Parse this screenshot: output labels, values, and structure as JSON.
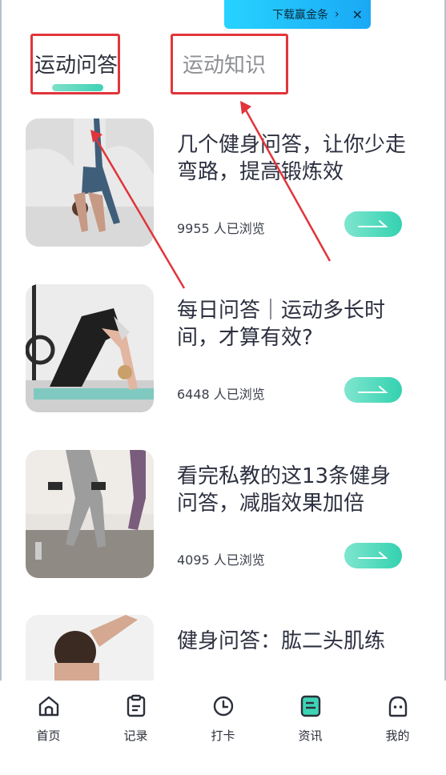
{
  "banner": {
    "text": "下载赢金条",
    "chevron": "›",
    "close": "✕"
  },
  "tabs": [
    {
      "label": "运动问答",
      "active": true
    },
    {
      "label": "运动知识",
      "active": false
    }
  ],
  "articles": [
    {
      "title": "几个健身问答，让你少走弯路，提高锻炼效",
      "views": "9955 人已浏览",
      "thumb": "backbend-pose"
    },
    {
      "title": "每日问答｜运动多长时间，才算有效?",
      "views": "6448 人已浏览",
      "thumb": "downward-dog-pose"
    },
    {
      "title": "看完私教的这13条健身问答，减脂效果加倍",
      "views": "4095 人已浏览",
      "thumb": "dumbbell-lunge"
    },
    {
      "title": "健身问答：肱二头肌练",
      "views": "",
      "thumb": "woman-portrait"
    }
  ],
  "nav": [
    {
      "label": "首页",
      "icon": "home-icon"
    },
    {
      "label": "记录",
      "icon": "clipboard-icon"
    },
    {
      "label": "打卡",
      "icon": "clock-icon"
    },
    {
      "label": "资讯",
      "icon": "news-icon"
    },
    {
      "label": "我的",
      "icon": "profile-icon"
    }
  ],
  "colors": {
    "accent": "#3ed3b5",
    "annotation": "#e0353a",
    "banner": "#1aa8f5"
  }
}
